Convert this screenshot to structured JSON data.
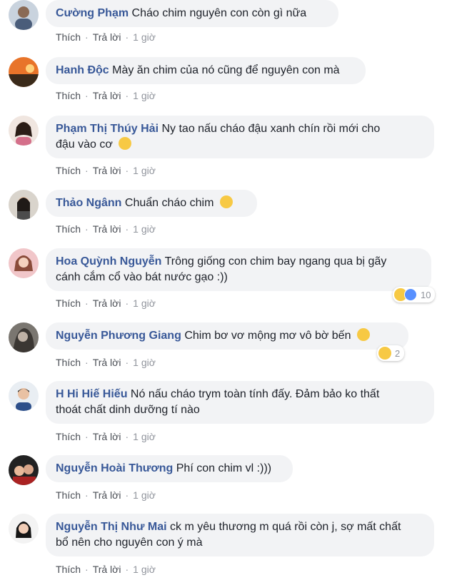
{
  "actions": {
    "like": "Thích",
    "reply": "Trả lời",
    "dot": "·",
    "time": "1 giờ"
  },
  "comments": [
    {
      "author": "Cường Phạm",
      "text": "Cháo chim nguyên con còn gì nữa"
    },
    {
      "author": "Hanh Độc",
      "text": "Mày ăn chim của nó cũng để nguyên con mà"
    },
    {
      "author": "Phạm Thị Thúy Hải",
      "text": "Ny tao nấu cháo đậu xanh chín rồi mới cho",
      "text2": "đậu vào cơ",
      "emoji": "rofl-emoji"
    },
    {
      "author": "Thảo Ngânn",
      "text": "Chuẩn cháo chim",
      "emoji": "laughing-emoji"
    },
    {
      "author": "Hoa Quỳnh Nguyễn",
      "text": "Trông giống con chim bay ngang qua bị gãy",
      "text2": "cánh cắm cổ vào bát nước gạo :))",
      "reactions": "10"
    },
    {
      "author": "Nguyễn Phương Giang",
      "text": "Chim bơ vơ mộng mơ vô bờ bến",
      "emoji": "relieved-emoji",
      "reactions": "2"
    },
    {
      "author": "H Hi Hiế Hiếu",
      "text": "Nó nấu cháo trym toàn tính đấy. Đảm bảo ko thất",
      "text2": "thoát chất dinh dưỡng tí nào"
    },
    {
      "author": "Nguyễn Hoài Thương",
      "text": "Phí con chim vl :)))"
    },
    {
      "author": "Nguyễn Thị Như Mai",
      "text": "ck m yêu thương m quá rồi còn j, sợ mất chất",
      "text2": "bổ nên cho nguyên con ý mà"
    }
  ],
  "colors": {
    "author": "#385898",
    "bubble": "#f2f3f5",
    "meta": "#90949c"
  }
}
